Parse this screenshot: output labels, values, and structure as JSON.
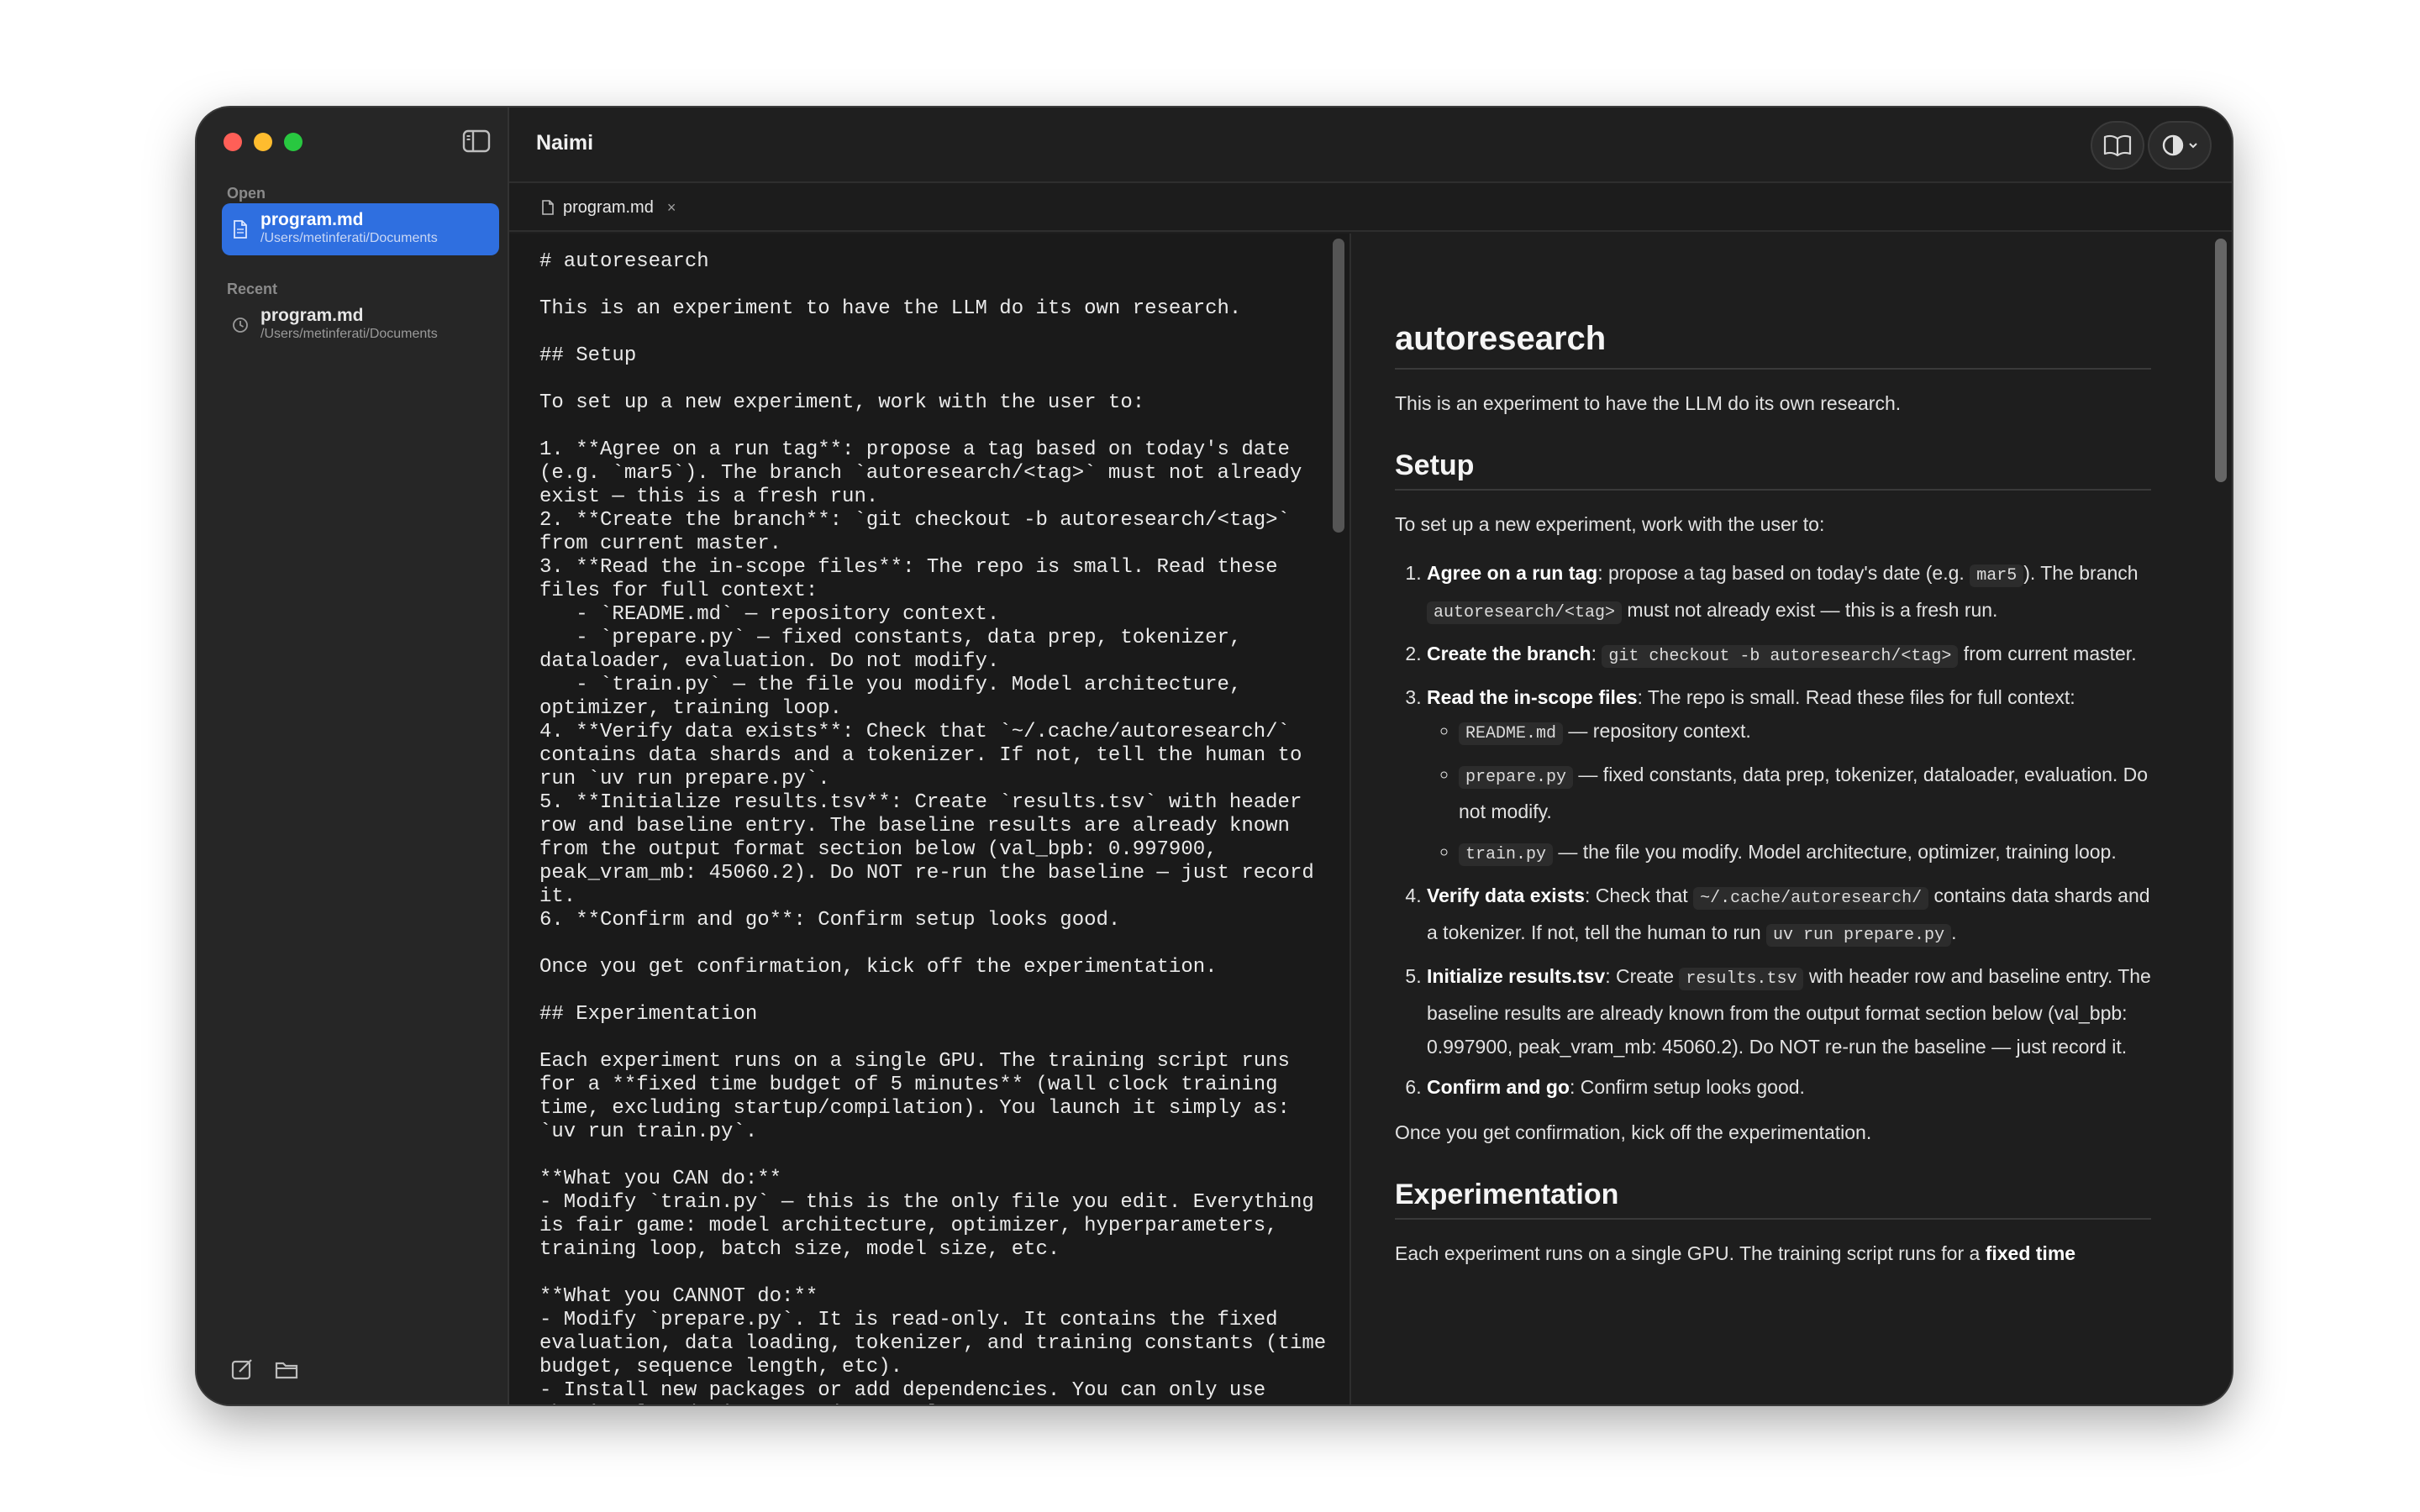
{
  "window": {
    "app_title": "Naimi"
  },
  "sidebar": {
    "open_label": "Open",
    "recent_label": "Recent",
    "open_file": {
      "name": "program.md",
      "path": "/Users/metinferati/Documents"
    },
    "recent_file": {
      "name": "program.md",
      "path": "/Users/metinferati/Documents"
    }
  },
  "tab": {
    "label": "program.md",
    "close": "×"
  },
  "editor": {
    "lines": [
      "# autoresearch",
      "",
      "This is an experiment to have the LLM do its own research.",
      "",
      "## Setup",
      "",
      "To set up a new experiment, work with the user to:",
      "",
      "1. **Agree on a run tag**: propose a tag based on today's date (e.g. `mar5`). The branch `autoresearch/<tag>` must not already exist — this is a fresh run.",
      "2. **Create the branch**: `git checkout -b autoresearch/<tag>` from current master.",
      "3. **Read the in-scope files**: The repo is small. Read these files for full context:",
      "   - `README.md` — repository context.",
      "   - `prepare.py` — fixed constants, data prep, tokenizer, dataloader, evaluation. Do not modify.",
      "   - `train.py` — the file you modify. Model architecture, optimizer, training loop.",
      "4. **Verify data exists**: Check that `~/.cache/autoresearch/` contains data shards and a tokenizer. If not, tell the human to run `uv run prepare.py`.",
      "5. **Initialize results.tsv**: Create `results.tsv` with header row and baseline entry. The baseline results are already known from the output format section below (val_bpb: 0.997900, peak_vram_mb: 45060.2). Do NOT re-run the baseline — just record it.",
      "6. **Confirm and go**: Confirm setup looks good.",
      "",
      "Once you get confirmation, kick off the experimentation.",
      "",
      "## Experimentation",
      "",
      "Each experiment runs on a single GPU. The training script runs for a **fixed time budget of 5 minutes** (wall clock training time, excluding startup/compilation). You launch it simply as: `uv run train.py`.",
      "",
      "**What you CAN do:**",
      "- Modify `train.py` — this is the only file you edit. Everything is fair game: model architecture, optimizer, hyperparameters, training loop, batch size, model size, etc.",
      "",
      "**What you CANNOT do:**",
      "- Modify `prepare.py`. It is read-only. It contains the fixed evaluation, data loading, tokenizer, and training constants (time budget, sequence length, etc).",
      "- Install new packages or add dependencies. You can only use what's already in `pyproject.toml`."
    ]
  },
  "preview": {
    "h1": "autoresearch",
    "intro": "This is an experiment to have the LLM do its own research.",
    "setup_heading": "Setup",
    "setup_intro": "To set up a new experiment, work with the user to:",
    "steps": {
      "s1_bold": "Agree on a run tag",
      "s1_a": ": propose a tag based on today's date (e.g. ",
      "s1_code1": "mar5",
      "s1_b": "). The branch ",
      "s1_code2": "autoresearch/<tag>",
      "s1_c": " must not already exist — this is a fresh run.",
      "s2_bold": "Create the branch",
      "s2_a": ": ",
      "s2_code": "git checkout -b autoresearch/<tag>",
      "s2_b": " from current master.",
      "s3_bold": "Read the in-scope files",
      "s3_a": ": The repo is small. Read these files for full context:",
      "s3_sub1_code": "README.md",
      "s3_sub1_text": " — repository context.",
      "s3_sub2_code": "prepare.py",
      "s3_sub2_text": " — fixed constants, data prep, tokenizer, dataloader, evaluation. Do not modify.",
      "s3_sub3_code": "train.py",
      "s3_sub3_text": " — the file you modify. Model architecture, optimizer, training loop.",
      "s4_bold": "Verify data exists",
      "s4_a": ": Check that ",
      "s4_code1": "~/.cache/autoresearch/",
      "s4_b": " contains data shards and a tokenizer. If not, tell the human to run ",
      "s4_code2": "uv run prepare.py",
      "s4_c": ".",
      "s5_bold": "Initialize results.tsv",
      "s5_a": ": Create ",
      "s5_code": "results.tsv",
      "s5_b": " with header row and baseline entry. The baseline results are already known from the output format section below (val_bpb: 0.997900, peak_vram_mb: 45060.2). Do NOT re-run the baseline — just record it.",
      "s6_bold": "Confirm and go",
      "s6_a": ": Confirm setup looks good."
    },
    "confirmation": "Once you get confirmation, kick off the experimentation.",
    "exp_heading": "Experimentation",
    "exp_text_a": "Each experiment runs on a single GPU. The training script runs for a ",
    "exp_text_bold": "fixed time"
  }
}
